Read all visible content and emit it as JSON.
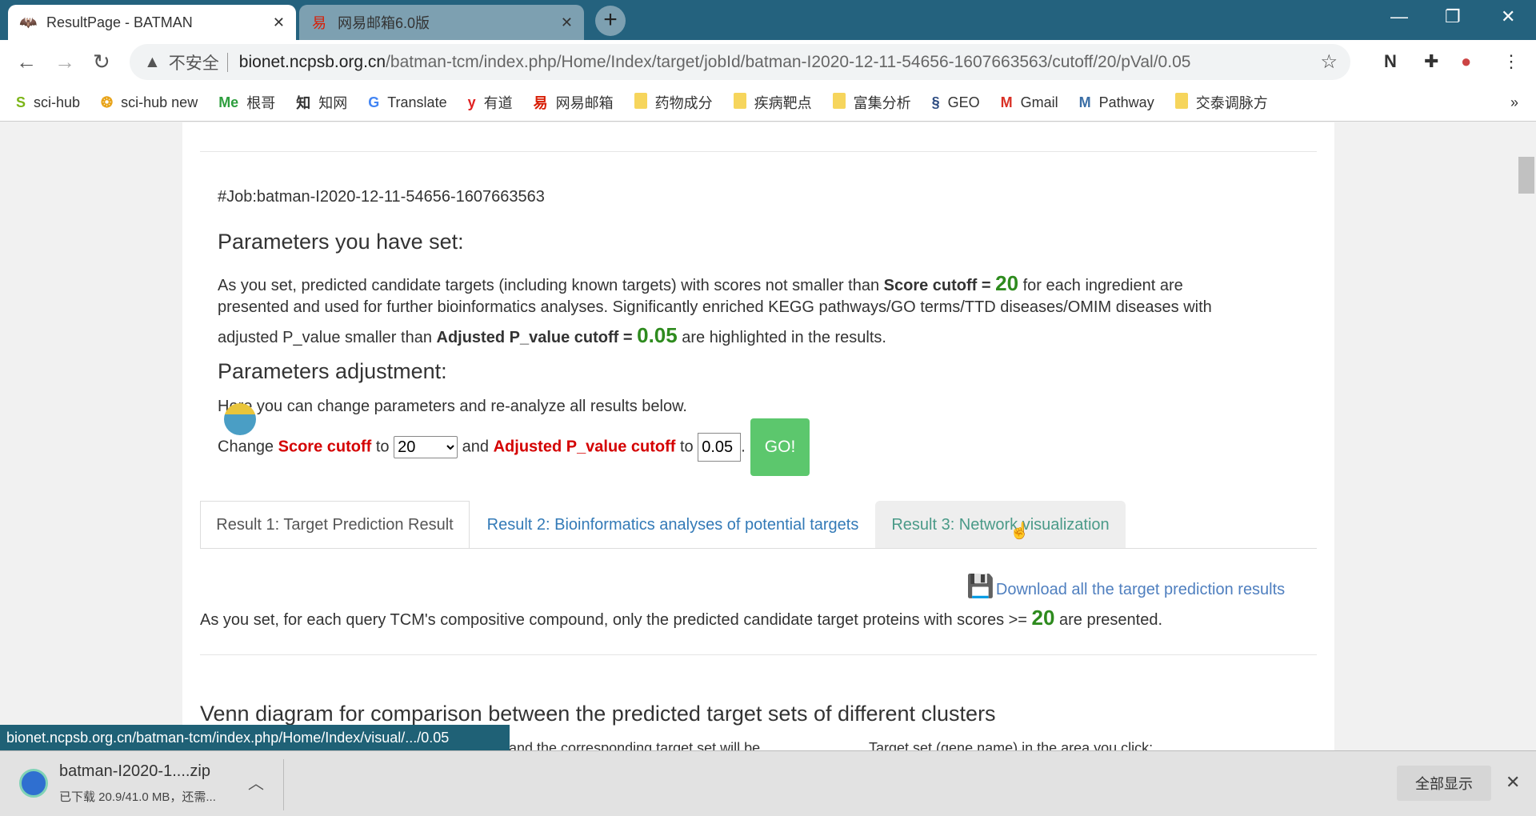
{
  "browser": {
    "tabs": [
      {
        "title": "ResultPage - BATMAN",
        "icon": "batman-icon"
      },
      {
        "title": "网易邮箱6.0版",
        "icon": "netease-icon"
      }
    ],
    "address": {
      "security": "不安全",
      "host": "bionet.ncpsb.org.cn",
      "path": "/batman-tcm/index.php/Home/Index/target/jobId/batman-I2020-12-11-54656-1607663563/cutoff/20/pVal/0.05"
    },
    "bookmarks": [
      {
        "label": "sci-hub",
        "icon": "S",
        "color": "#7cb518"
      },
      {
        "label": "sci-hub new",
        "icon": "❂",
        "color": "#e8a317"
      },
      {
        "label": "根哥",
        "icon": "Me",
        "color": "#2e9e3e"
      },
      {
        "label": "知网",
        "icon": "知",
        "color": "#333"
      },
      {
        "label": "Translate",
        "icon": "G",
        "color": "#4285f4"
      },
      {
        "label": "有道",
        "icon": "y",
        "color": "#e02020"
      },
      {
        "label": "网易邮箱",
        "icon": "易",
        "color": "#d81e06"
      },
      {
        "label": "药物成分",
        "icon": "folder"
      },
      {
        "label": "疾病靶点",
        "icon": "folder"
      },
      {
        "label": "富集分析",
        "icon": "folder"
      },
      {
        "label": "GEO",
        "icon": "§",
        "color": "#2b4a80"
      },
      {
        "label": "Gmail",
        "icon": "M",
        "color": "#d93025"
      },
      {
        "label": "Pathway",
        "icon": "M",
        "color": "#3a6ea5"
      },
      {
        "label": "交泰调脉方",
        "icon": "folder"
      }
    ],
    "more": "»",
    "status_url": "bionet.ncpsb.org.cn/batman-tcm/index.php/Home/Index/visual/.../0.05"
  },
  "page": {
    "job": "#Job:batman-I2020-12-11-54656-1607663563",
    "params_heading": "Parameters you have set:",
    "p1a": "As you set, predicted candidate targets (including known targets) with scores not smaller than ",
    "p1b": "Score cutoff = ",
    "score": "20",
    "p1c": " for each ingredient are",
    "p2": "presented and used for further bioinformatics analyses. Significantly enriched KEGG pathways/GO terms/TTD diseases/OMIM diseases with",
    "p3a": "adjusted P_value smaller than ",
    "p3b": "Adjusted P_value cutoff = ",
    "pval": "0.05",
    "p3c": " are highlighted in the results.",
    "adj_heading": "Parameters adjustment:",
    "adj_text": "Here you can change parameters and re-analyze all results below.",
    "change": "Change ",
    "score_label": "Score cutoff",
    "to": " to ",
    "and": " and ",
    "pval_label": "Adjusted P_value cutoff",
    "score_select": "20",
    "pval_input": "0.05",
    "go": "GO!",
    "tabs": [
      "Result 1: Target Prediction Result",
      "Result 2: Bioinformatics analyses of potential targets",
      "Result 3: Network visualization"
    ],
    "download": "Download all the target prediction results",
    "presented_a": "As you set, for each query TCM's compositive compound, only the predicted candidate target proteins with scores >= ",
    "presented_b": " are presented.",
    "venn_heading": "Venn diagram for comparison between the predicted target sets of different clusters",
    "cut1": "and the corresponding target set will be",
    "cut2": "Target set (gene name) in the area you click:"
  },
  "download": {
    "file": "batman-I2020-1....zip",
    "progress": "已下载 20.9/41.0 MB，还需...",
    "show_all": "全部显示"
  },
  "colors": {
    "green": "#2e8b1e",
    "red": "#d40000",
    "link": "#337ab7",
    "go": "#5cc76d",
    "chrome": "#24627e"
  }
}
